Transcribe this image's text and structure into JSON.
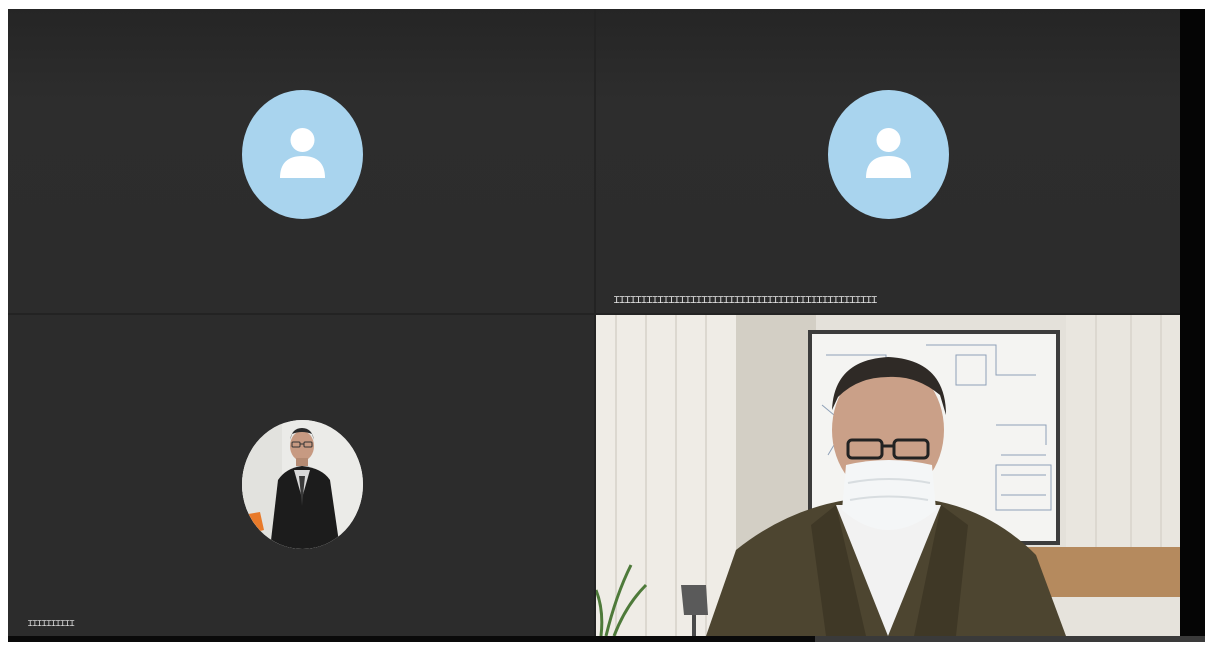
{
  "meeting": {
    "participants": [
      {
        "name": "",
        "video": "off",
        "avatar": "default-user-icon"
      },
      {
        "name": "ꞮꞮꞮꞮꞮꞮꞮꞮꞮꞮꞮꞮꞮꞮꞮꞮꞮꞮꞮꞮꞮꞮꞮꞮꞮꞮꞮꞮꞮꞮꞮꞮꞮꞮꞮꞮꞮꞮꞮꞮꞮꞮꞮꞮꞮꞮꞮꞮ",
        "video": "off",
        "avatar": "default-user-icon"
      },
      {
        "name": "ꞮꞮꞮꞮꞮꞮꞮꞮꞮꞮ",
        "video": "off",
        "avatar": "profile-photo"
      },
      {
        "name": "",
        "video": "on",
        "avatar": "live-video"
      }
    ]
  },
  "colors": {
    "tile_bg": "#2c2c2c",
    "avatar_bg": "#a9d4ee",
    "avatar_icon": "#ffffff",
    "label_text": "#e8e8e8"
  }
}
